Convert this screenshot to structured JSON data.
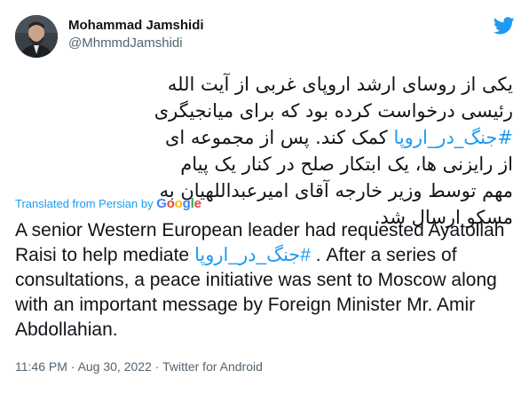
{
  "author": {
    "name": "Mohammad Jamshidi",
    "handle": "@MhmmdJamshidi"
  },
  "icons": {
    "platform_logo": "twitter-bird-icon",
    "platform_color": "#1d9bf0"
  },
  "tweet": {
    "persian_before": "یکی از روسای ارشد اروپای غربی از آیت الله رئیسی درخواست کرده بود که برای میانجیگری ",
    "persian_hashtag": "#جنگ_در_اروپا",
    "persian_after": " کمک کند. پس از مجموعه ای از رایزنی ها، یک ابتکار صلح در کنار یک پیام مهم توسط وزیر خارجه آقای امیرعبداللهیان به مسکو ارسال شد.",
    "translated_label": "Translated from Persian by",
    "translator": "Google",
    "english_before": "A senior Western European leader had requested Ayatollah Raisi to help mediate ",
    "english_hashtag": "#جنگ_در_اروپا",
    "english_after": " . After a series of consultations, a peace initiative was sent to Moscow along with an important message by Foreign Minister Mr. Amir Abdollahian."
  },
  "meta": {
    "time": "11:46 PM",
    "separator1": " · ",
    "date": "Aug 30, 2022",
    "separator2": " · ",
    "source": "Twitter for Android"
  }
}
